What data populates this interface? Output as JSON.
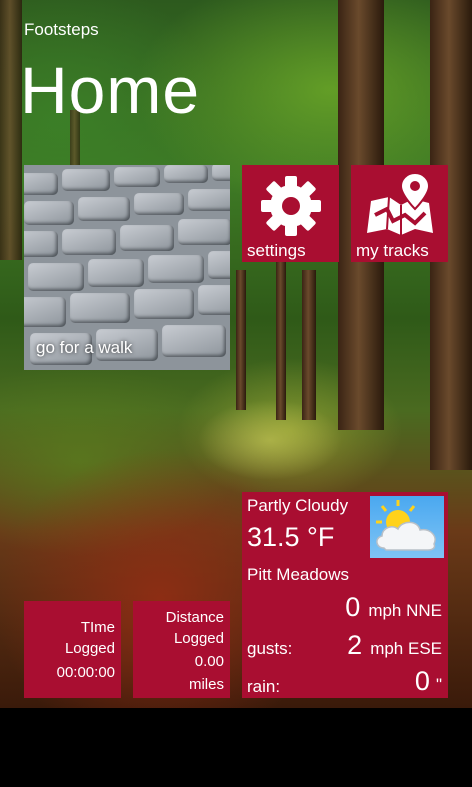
{
  "app_title": "Footsteps",
  "page_title": "Home",
  "tiles": {
    "walk": {
      "label": "go for a walk",
      "icon": "cobblestone-image"
    },
    "settings": {
      "label": "settings",
      "icon": "gear-icon"
    },
    "tracks": {
      "label": "my tracks",
      "icon": "map-pin-icon"
    },
    "time": {
      "line1": "TIme",
      "line2": "Logged",
      "line3": "00:00:00"
    },
    "distance": {
      "line1": "Distance",
      "line2": "Logged",
      "line3": "0.00",
      "line4": "miles"
    }
  },
  "weather": {
    "condition": "Partly Cloudy",
    "temperature": "31.5 °F",
    "location": "Pitt Meadows",
    "wind_speed": "0",
    "wind_unit_dir": "mph NNE",
    "gusts_label": "gusts:",
    "gusts_speed": "2",
    "gusts_unit_dir": "mph ESE",
    "rain_label": "rain:",
    "rain_value": "0",
    "rain_unit": "\"",
    "icon": "partly-cloudy-icon"
  },
  "colors": {
    "tile": "#a90e31",
    "sky": "#4aa8f0"
  }
}
